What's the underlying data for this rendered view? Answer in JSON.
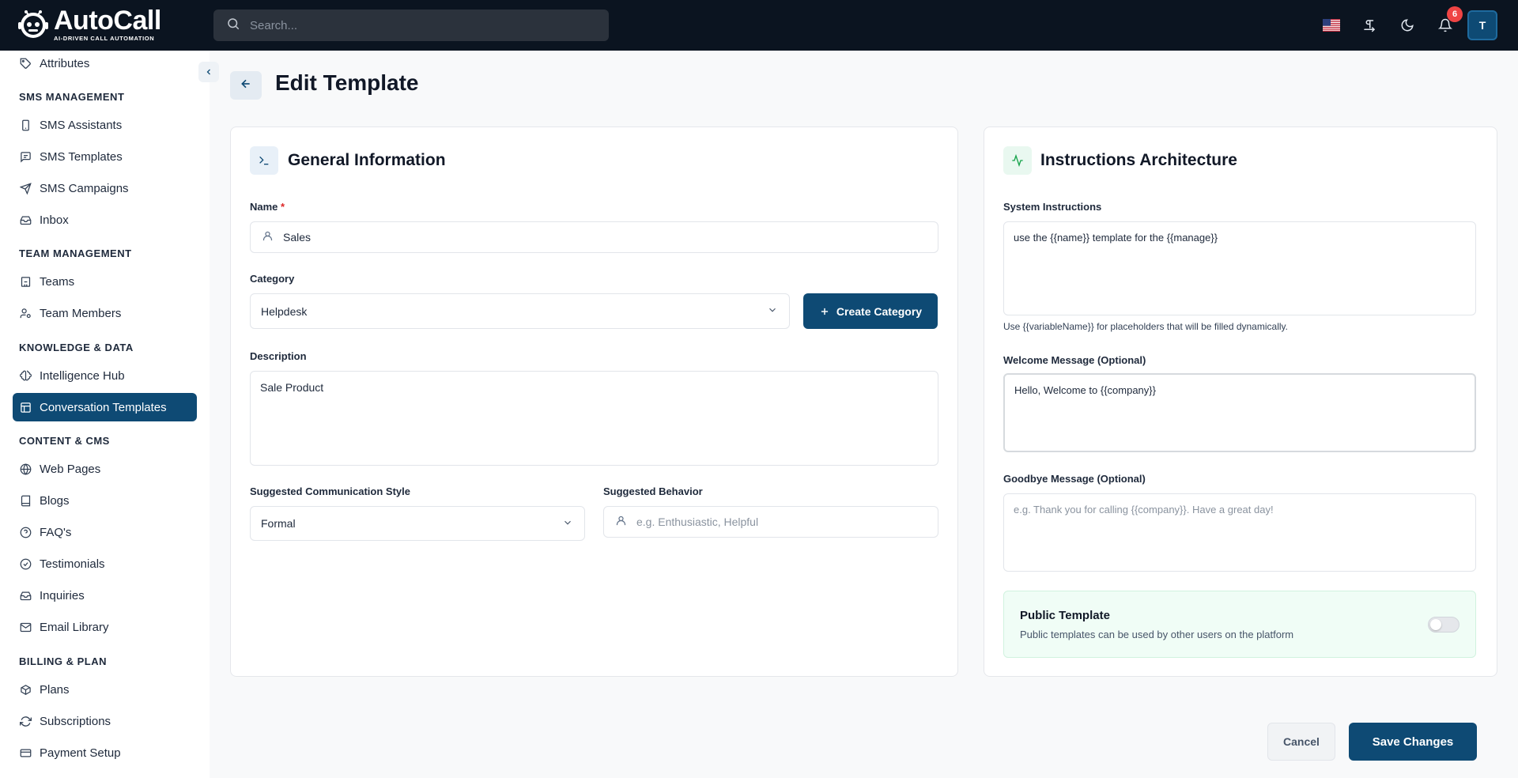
{
  "app": {
    "logo_title_auto": "Auto",
    "logo_title_call": "Call",
    "logo_subtitle": "AI-DRIVEN CALL AUTOMATION"
  },
  "header": {
    "search_placeholder": "Search...",
    "notification_count": "6",
    "avatar_initial": "T"
  },
  "sidebar": {
    "items": [
      {
        "label": "Attributes",
        "icon": "tag-icon"
      },
      {
        "section": "SMS MANAGEMENT"
      },
      {
        "label": "SMS Assistants",
        "icon": "phone-icon"
      },
      {
        "label": "SMS Templates",
        "icon": "message-icon"
      },
      {
        "label": "SMS Campaigns",
        "icon": "send-icon"
      },
      {
        "label": "Inbox",
        "icon": "inbox-icon"
      },
      {
        "section": "TEAM MANAGEMENT"
      },
      {
        "label": "Teams",
        "icon": "building-icon"
      },
      {
        "label": "Team Members",
        "icon": "user-cog-icon"
      },
      {
        "section": "KNOWLEDGE & DATA"
      },
      {
        "label": "Intelligence Hub",
        "icon": "brain-icon"
      },
      {
        "label": "Conversation Templates",
        "icon": "template-icon",
        "active": true
      },
      {
        "section": "CONTENT & CMS"
      },
      {
        "label": "Web Pages",
        "icon": "globe-icon"
      },
      {
        "label": "Blogs",
        "icon": "book-icon"
      },
      {
        "label": "FAQ's",
        "icon": "help-circle-icon"
      },
      {
        "label": "Testimonials",
        "icon": "check-circle-icon"
      },
      {
        "label": "Inquiries",
        "icon": "inbox-icon"
      },
      {
        "label": "Email Library",
        "icon": "mail-icon"
      },
      {
        "section": "BILLING & PLAN"
      },
      {
        "label": "Plans",
        "icon": "package-icon"
      },
      {
        "label": "Subscriptions",
        "icon": "refresh-icon"
      },
      {
        "label": "Payment Setup",
        "icon": "credit-card-icon"
      }
    ]
  },
  "page": {
    "title": "Edit Template"
  },
  "general": {
    "title": "General Information",
    "name_label": "Name",
    "name_required": "*",
    "name_value": "Sales",
    "category_label": "Category",
    "category_value": "Helpdesk",
    "create_category": "Create Category",
    "description_label": "Description",
    "description_value": "Sale Product",
    "style_label": "Suggested Communication Style",
    "style_value": "Formal",
    "behavior_label": "Suggested Behavior",
    "behavior_placeholder": "e.g. Enthusiastic, Helpful"
  },
  "instructions": {
    "title": "Instructions Architecture",
    "system_label": "System Instructions",
    "system_value": "use the {{name}} template for the {{manage}}",
    "hint": "Use {{variableName}} for placeholders that will be filled dynamically.",
    "welcome_label": "Welcome Message (Optional)",
    "welcome_value": "Hello, Welcome to {{company}}",
    "goodbye_label": "Goodbye Message (Optional)",
    "goodbye_placeholder": "e.g. Thank you for calling {{company}}. Have a great day!",
    "public_title": "Public Template",
    "public_desc": "Public templates can be used by other users on the platform",
    "public_enabled": false
  },
  "actions": {
    "cancel": "Cancel",
    "save": "Save Changes"
  },
  "colors": {
    "primary": "#0e4a74",
    "topbar": "#0b1420",
    "badge": "#ef4444",
    "public_bg": "#f0fdf6"
  }
}
